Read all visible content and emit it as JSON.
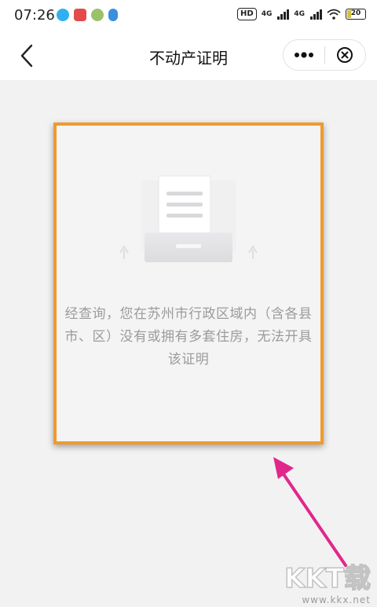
{
  "status_bar": {
    "time": "07:26",
    "hd_badge": "HD",
    "network_1": "4G",
    "network_2": "4G",
    "battery": "20",
    "battery_level": 0.2
  },
  "nav": {
    "title": "不动产证明",
    "back_icon": "chevron-left-icon",
    "more_icon": "more-dots-icon",
    "close_icon": "close-circle-icon"
  },
  "result": {
    "message": "经查询，您在苏州市行政区域内（含各县市、区）没有或拥有多套住房，无法开具该证明",
    "illustration_icon": "document-empty-icon"
  },
  "annotation": {
    "highlight_color": "#ef9a2c",
    "arrow_color": "#e0288c"
  },
  "watermark": {
    "logo": "KKT载",
    "url": "www.kkx.net"
  }
}
